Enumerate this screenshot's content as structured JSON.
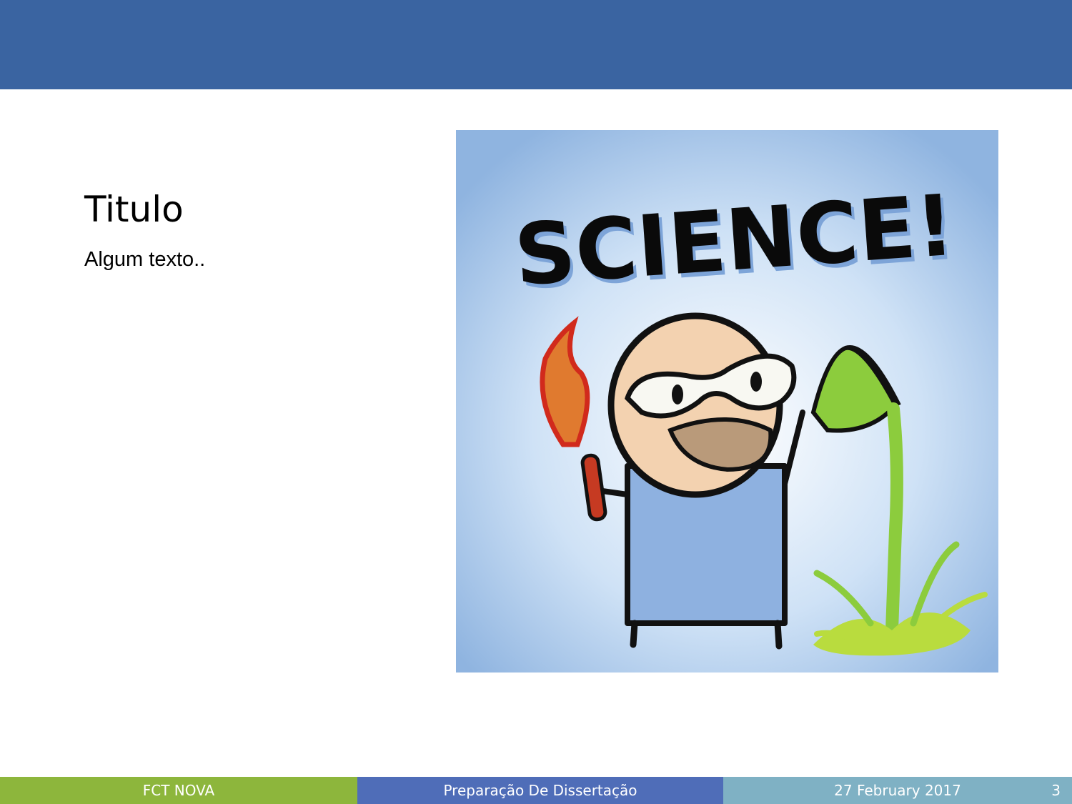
{
  "slide": {
    "title": "Titulo",
    "body": "Algum texto..",
    "image_word": "SCIENCE!"
  },
  "footer": {
    "organization": "FCT NOVA",
    "course": "Preparação De Dissertação",
    "date": "27 February 2017",
    "page_number": "3"
  },
  "colors": {
    "banner": "#3a64a1",
    "footer_org": "#8db63c",
    "footer_course": "#4f6db8",
    "footer_date": "#7fb1c4"
  }
}
